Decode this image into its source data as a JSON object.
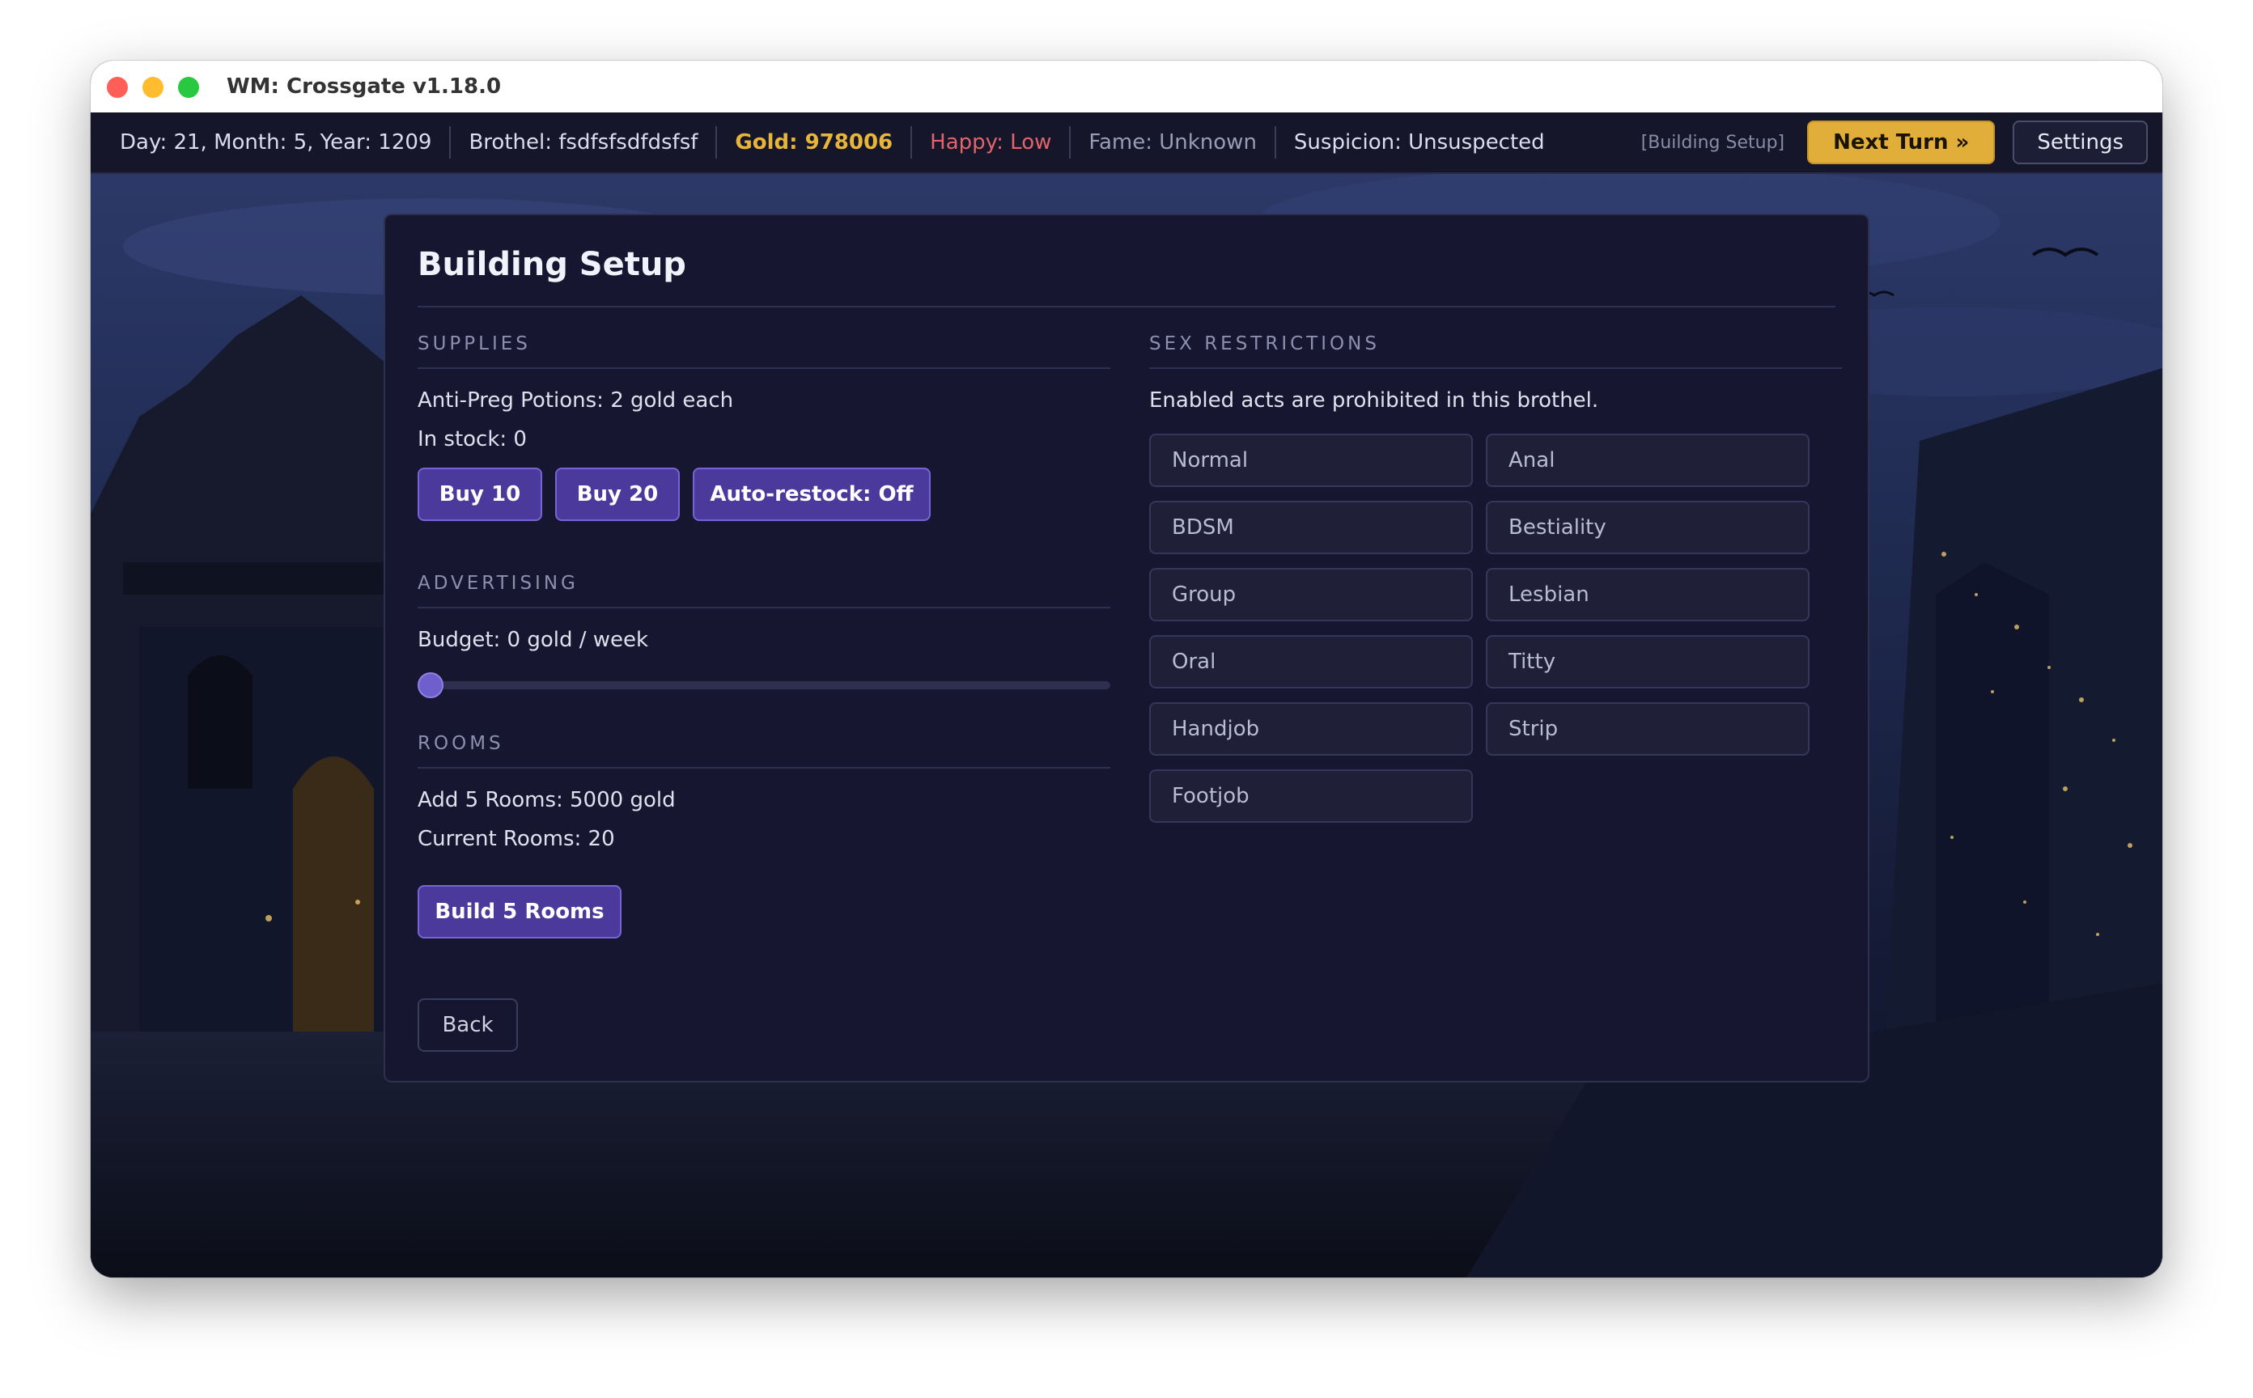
{
  "window": {
    "title": "WM: Crossgate v1.18.0"
  },
  "statusbar": {
    "date": "Day: 21, Month: 5, Year: 1209",
    "brothel": "Brothel: fsdfsfsdfdsfsf",
    "gold": "Gold: 978006",
    "happy": "Happy: Low",
    "fame": "Fame: Unknown",
    "suspicion": "Suspicion: Unsuspected",
    "screen_tag": "[Building Setup]",
    "next_turn": "Next Turn »",
    "settings": "Settings"
  },
  "colors": {
    "accent": "#4b3a9c",
    "gold": "#e2ae3a",
    "happy": "#e0656b",
    "panel": "#161630"
  },
  "panel": {
    "title": "Building Setup",
    "supplies": {
      "heading": "SUPPLIES",
      "price": "Anti-Preg Potions: 2 gold each",
      "stock": "In stock: 0",
      "buy10": "Buy 10",
      "buy20": "Buy 20",
      "autorestock": "Auto-restock: Off"
    },
    "advertising": {
      "heading": "ADVERTISING",
      "budget": "Budget: 0 gold / week",
      "slider_value": 0
    },
    "rooms": {
      "heading": "ROOMS",
      "add": "Add 5 Rooms: 5000 gold",
      "current": "Current Rooms: 20",
      "build": "Build 5 Rooms"
    },
    "restrictions": {
      "heading": "SEX RESTRICTIONS",
      "note": "Enabled acts are prohibited in this brothel.",
      "acts": [
        "Normal",
        "Anal",
        "BDSM",
        "Bestiality",
        "Group",
        "Lesbian",
        "Oral",
        "Titty",
        "Handjob",
        "Strip",
        "Footjob"
      ]
    },
    "back": "Back"
  }
}
